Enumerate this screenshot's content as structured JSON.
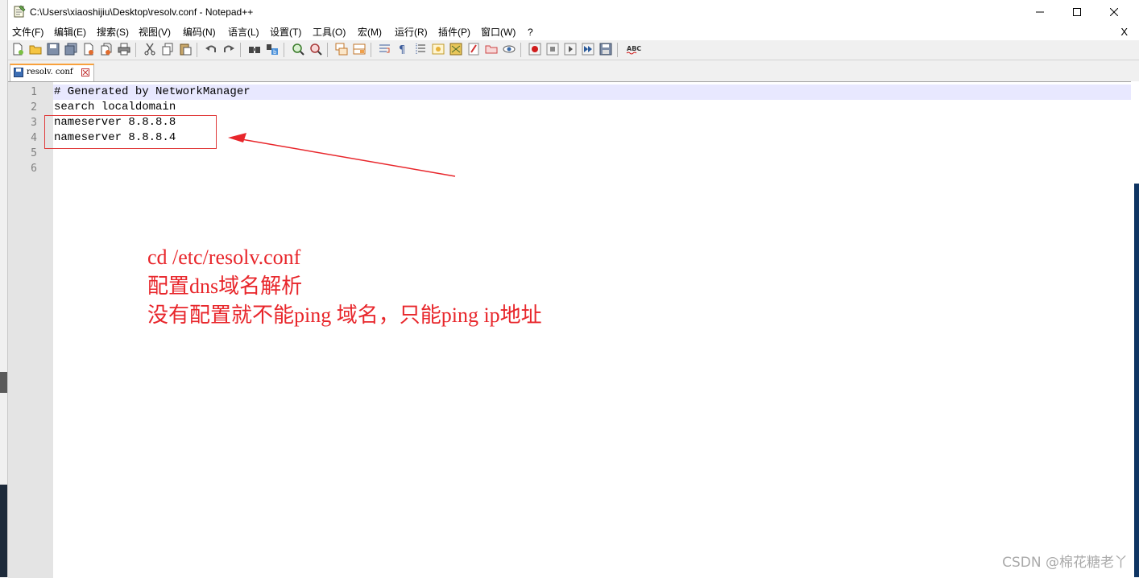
{
  "window": {
    "title": "C:\\Users\\xiaoshijiu\\Desktop\\resolv.conf - Notepad++",
    "doc_close": "X"
  },
  "menu": [
    "文件(F)",
    "编辑(E)",
    "搜索(S)",
    "视图(V)",
    "编码(N)",
    "语言(L)",
    "设置(T)",
    "工具(O)",
    "宏(M)",
    "运行(R)",
    "插件(P)",
    "窗口(W)",
    "?"
  ],
  "toolbar": {
    "icons": [
      "new-file-icon",
      "open-file-icon",
      "save-icon",
      "save-all-icon",
      "close-icon",
      "close-all-icon",
      "print-icon",
      "cut-icon",
      "copy-icon",
      "paste-icon",
      "undo-icon",
      "redo-icon",
      "find-icon",
      "replace-icon",
      "zoom-in-icon",
      "zoom-out-icon",
      "sync-vertical-icon",
      "sync-horizontal-icon",
      "word-wrap-icon",
      "show-all-chars-icon",
      "indent-guide-icon",
      "udl-icon",
      "doc-map-icon",
      "function-list-icon",
      "folder-as-workspace-icon",
      "monitoring-icon",
      "record-macro-icon",
      "stop-macro-icon",
      "play-macro-icon",
      "run-macro-multiple-icon",
      "save-macro-icon",
      "spellcheck-icon"
    ],
    "spellcheck_label": "ABC"
  },
  "tab": {
    "label": "resolv. conf"
  },
  "editor": {
    "line_numbers": [
      "1",
      "2",
      "3",
      "4",
      "5",
      "6"
    ],
    "lines": [
      "# Generated by NetworkManager",
      "search localdomain",
      "nameserver 8.8.8.8",
      "nameserver 8.8.8.4",
      "",
      ""
    ]
  },
  "annotation": {
    "lines": [
      "cd /etc/resolv.conf",
      "配置dns域名解析",
      "没有配置就不能ping 域名，只能ping ip地址"
    ],
    "color": "#e8262b"
  },
  "watermark": "CSDN @棉花糖老丫"
}
